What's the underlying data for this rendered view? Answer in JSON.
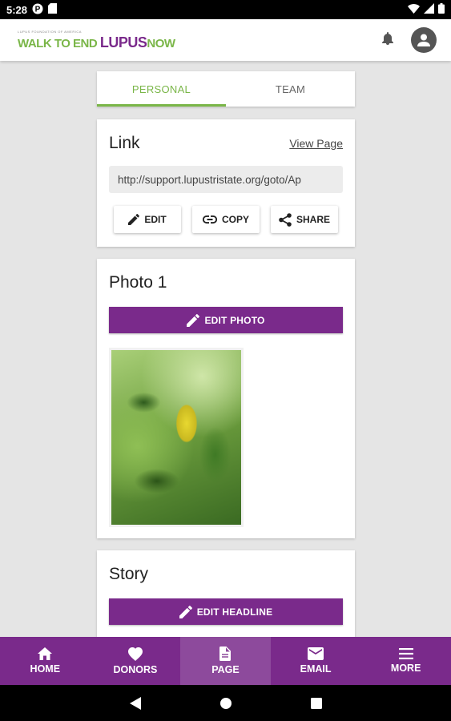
{
  "status_bar": {
    "time": "5:28"
  },
  "app_bar": {
    "logo": {
      "small": "LUPUS FOUNDATION OF AMERICA",
      "part1": "WALK TO END ",
      "part2": "LUPUS",
      "part3": "NOW"
    }
  },
  "tabs": [
    {
      "label": "PERSONAL",
      "active": true
    },
    {
      "label": "TEAM",
      "active": false
    }
  ],
  "link_card": {
    "title": "Link",
    "view_page": "View Page",
    "url": "http://support.lupustristate.org/goto/Ap",
    "buttons": {
      "edit": "EDIT",
      "copy": "COPY",
      "share": "SHARE"
    }
  },
  "photo_card": {
    "title": "Photo 1",
    "edit_button": "EDIT PHOTO"
  },
  "story_card": {
    "title": "Story",
    "edit_button": "EDIT HEADLINE"
  },
  "bottom_nav": [
    {
      "label": "HOME",
      "icon": "home-icon"
    },
    {
      "label": "DONORS",
      "icon": "heart-icon"
    },
    {
      "label": "PAGE",
      "icon": "document-icon",
      "active": true
    },
    {
      "label": "EMAIL",
      "icon": "email-icon"
    },
    {
      "label": "MORE",
      "icon": "menu-icon"
    }
  ],
  "colors": {
    "brand_purple": "#7a2a8b",
    "brand_green": "#7ab648",
    "background": "#e5e5e5"
  }
}
